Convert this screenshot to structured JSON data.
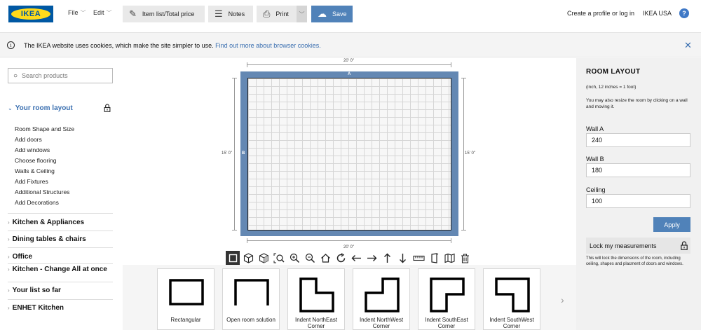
{
  "header": {
    "logo_text": "IKEA",
    "menus": [
      {
        "label": "File"
      },
      {
        "label": "Edit"
      }
    ],
    "buttons": {
      "item_list": "Item list/Total price",
      "notes": "Notes",
      "print": "Print",
      "save": "Save"
    },
    "links": {
      "profile": "Create a profile or log in",
      "country": "IKEA USA",
      "help": "?"
    }
  },
  "cookie_bar": {
    "text": "The IKEA website uses cookies, which make the site simpler to use.",
    "link": "Find out more about browser cookies."
  },
  "sidebar": {
    "search_placeholder": "Search products",
    "active_section": "Your room layout",
    "room_items": [
      "Room Shape and Size",
      "Add doors",
      "Add windows",
      "Choose flooring",
      "Walls & Ceiling",
      "Add Fixtures",
      "Additional Structures",
      "Add Decorations"
    ],
    "sections": [
      "Kitchen & Appliances",
      "Dining tables & chairs",
      "Office",
      "Kitchen - Change All at once",
      "Your list so far",
      "ENHET Kitchen"
    ]
  },
  "canvas": {
    "top_dim": "20' 0\"",
    "bottom_dim": "20' 0\"",
    "left_dim": "15' 0\"",
    "right_dim": "15' 0\"",
    "wall_a": "A",
    "wall_b": "B"
  },
  "toolbar_icons": [
    "2d-view-icon",
    "3d-view-icon",
    "3d-box-icon",
    "zoom-fit-icon",
    "zoom-in-icon",
    "zoom-out-icon",
    "home-icon",
    "rotate-icon",
    "arrow-left-icon",
    "arrow-right-icon",
    "arrow-up-icon",
    "arrow-down-icon",
    "measure-icon",
    "door-icon",
    "map-icon",
    "trash-icon"
  ],
  "shapes": [
    "Rectangular",
    "Open room solution",
    "Indent NorthEast Corner",
    "Indent NorthWest Corner",
    "Indent SouthEast Corner",
    "Indent SouthWest Corner"
  ],
  "right_panel": {
    "title": "ROOM LAYOUT",
    "unit_note": "(inch, 12 inches = 1 foot)",
    "resize_note": "You may also resize the room by clicking on a wall and moving it.",
    "wall_a_label": "Wall A",
    "wall_a_value": "240",
    "wall_b_label": "Wall B",
    "wall_b_value": "180",
    "ceiling_label": "Ceiling",
    "ceiling_value": "100",
    "apply_label": "Apply",
    "lock_label": "Lock my measurements",
    "lock_note": "This will lock the dimensions of the room, including ceiling, shapes and placment of doors and windows."
  },
  "colors": {
    "accent": "#5082b9",
    "wall": "#6488b3",
    "logo_blue": "#0058a3",
    "logo_yellow": "#ffda1a"
  }
}
